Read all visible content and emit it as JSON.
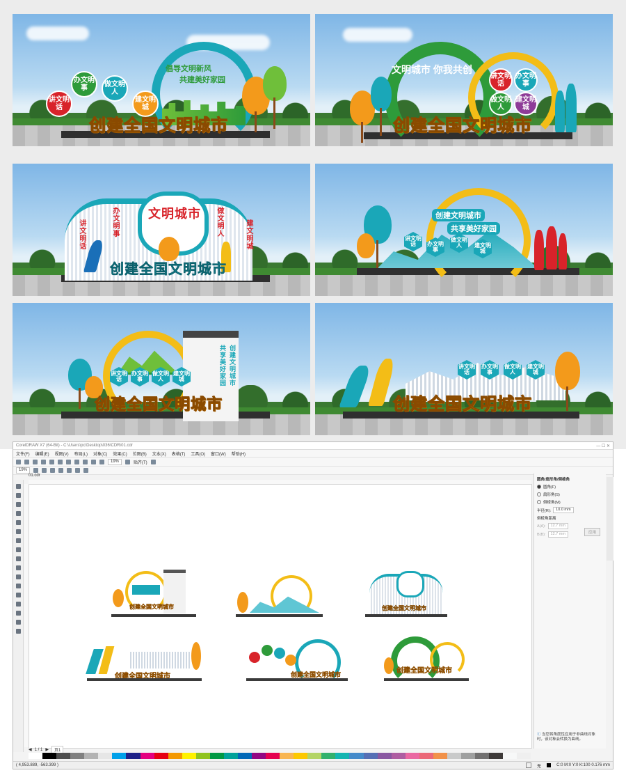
{
  "renders": [
    {
      "title": "创建全国文明城市",
      "arch_lines": [
        "倡导文明新风",
        "共建美好家园"
      ],
      "badges": [
        "讲文明话",
        "办文明事",
        "做文明人",
        "建文明城"
      ]
    },
    {
      "title": "创建全国文明城市",
      "arch_text": "文明城市 你我共创",
      "badges": [
        "讲文明话",
        "办文明事",
        "做文明人",
        "建文明城"
      ]
    },
    {
      "title": "创建全国文明城市",
      "center_text": "文明城市",
      "side_texts": [
        "讲文明话",
        "办文明事",
        "做文明人",
        "建文明城"
      ]
    },
    {
      "arch_lines": [
        "创建文明城市",
        "共享美好家园"
      ],
      "badges": [
        "讲文明话",
        "办文明事",
        "做文明人",
        "建文明城"
      ]
    },
    {
      "title": "创建全国文明城市",
      "badges": [
        "讲文明话",
        "办文明事",
        "做文明人",
        "建文明城"
      ],
      "vertical_texts": [
        "创建文明城市",
        "共享美好家园"
      ]
    },
    {
      "title": "创建全国文明城市",
      "badges": [
        "讲文明话",
        "办文明事",
        "做文明人",
        "建文明城"
      ]
    }
  ],
  "window": {
    "title": "CorelDRAW X7 (64-Bit) - C:\\Users\\pc\\Desktop\\036\\CDR\\01.cdr",
    "menu": [
      "文件(F)",
      "编辑(E)",
      "视图(V)",
      "布局(L)",
      "对象(C)",
      "效果(C)",
      "位图(B)",
      "文本(X)",
      "表格(T)",
      "工具(O)",
      "窗口(W)",
      "帮助(H)"
    ],
    "toolbar_zoom": "19%",
    "toolbar_snap": "贴齐(T)",
    "prop_zoom": "19%",
    "doc_tab": "01.cdr",
    "page_indicator": "1 / 1",
    "page_tab": "页1",
    "canvas_thumb_titles": [
      "创建全国文明城市",
      "创建全国文明城市",
      "创建全国文明城市",
      "创建全国文明城市",
      "创建全国文明城市",
      "创建全国文明城市"
    ],
    "docker": {
      "title": "圆角/扇形角/倒棱角",
      "options": [
        "圆角(F)",
        "扇形角(S)",
        "倒棱角(M)"
      ],
      "radius_label": "半径(R):",
      "radius_value": "10.0 mm",
      "distance_label": "倒棱角距离",
      "d1_label": "A(A):",
      "d1_value": "12.7 mm",
      "d2_label": "B(B):",
      "d2_value": "12.7 mm",
      "apply": "应用",
      "note": "当您将角度性应用于非曲线对象时，该对象会转换为曲线。"
    },
    "status": {
      "coords": "( 4,953.889, -563.399 )",
      "fill": "无",
      "outline": "C:0 M:0 Y:0 K:100  0.176 mm"
    }
  },
  "colors": {
    "title_yellow": "#f7c21a",
    "teal": "#1aa7b8",
    "green": "#2e9b3a",
    "red": "#d8232a",
    "orange": "#f39a1b",
    "purple": "#8e3b98"
  }
}
